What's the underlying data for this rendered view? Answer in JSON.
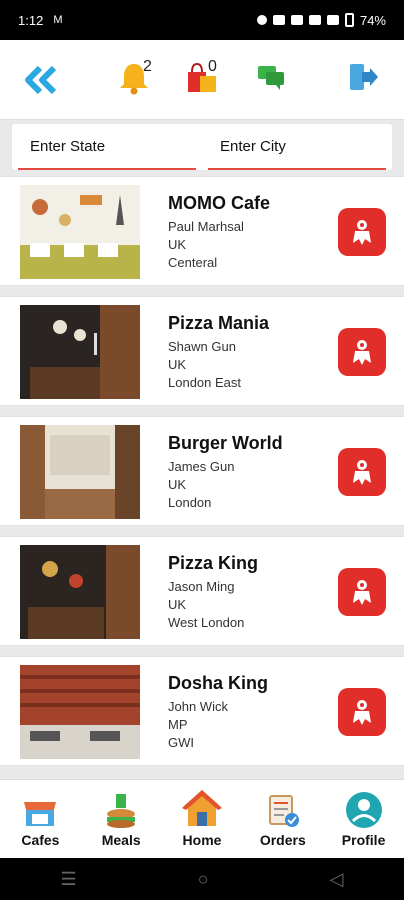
{
  "status_bar": {
    "time": "1:12",
    "battery": "74%"
  },
  "top_bar": {
    "notifications_count": "2",
    "cart_count": "0"
  },
  "search": {
    "state_placeholder": "Enter State",
    "city_placeholder": "Enter City"
  },
  "cafes": [
    {
      "name": "MOMO Cafe",
      "owner": "Paul Marhsal",
      "country": "UK",
      "area": "Centeral"
    },
    {
      "name": "Pizza Mania",
      "owner": "Shawn Gun",
      "country": "UK",
      "area": "London East"
    },
    {
      "name": "Burger World",
      "owner": "James Gun",
      "country": "UK",
      "area": "London"
    },
    {
      "name": "Pizza King",
      "owner": "Jason Ming",
      "country": "UK",
      "area": "West London"
    },
    {
      "name": "Dosha King",
      "owner": "John Wick",
      "country": "MP",
      "area": "GWI"
    }
  ],
  "bottom_nav": {
    "cafes": "Cafes",
    "meals": "Meals",
    "home": "Home",
    "orders": "Orders",
    "profile": "Profile"
  },
  "colors": {
    "accent_red": "#e12e2a",
    "back_blue": "#29a9e0",
    "bell_yellow": "#f5b21a",
    "chat_green": "#3bb34a"
  },
  "icons": {
    "back": "double-chevron-left-icon",
    "notifications": "bell-icon",
    "cart": "shopping-bag-icon",
    "chat": "chat-icon",
    "logout": "logout-icon",
    "cafe_action": "mascot-icon"
  }
}
